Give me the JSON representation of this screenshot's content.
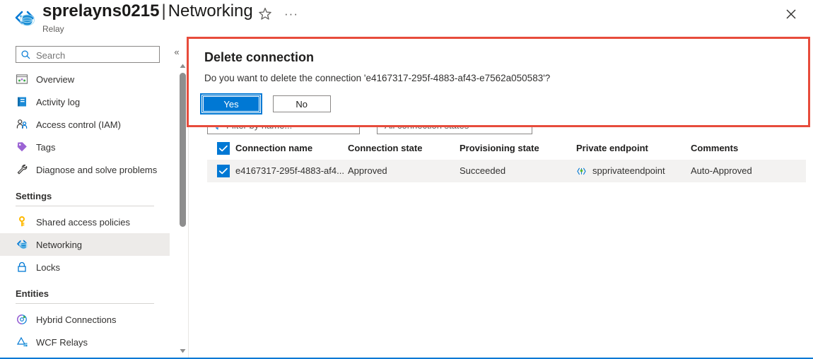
{
  "header": {
    "resource_name": "sprelayns0215",
    "separator": "|",
    "page_name": "Networking",
    "subtitle": "Relay",
    "resource_icon": "relay-icon",
    "favorite_icon": "star-icon",
    "more_icon": "ellipsis-icon",
    "close_icon": "close-icon"
  },
  "sidebar": {
    "search": {
      "placeholder": "Search",
      "value": "",
      "icon": "search-icon"
    },
    "collapse_icon": "chevron-double-left-icon",
    "items": [
      {
        "label": "Overview",
        "icon": "overview-icon",
        "selected": false
      },
      {
        "label": "Activity log",
        "icon": "activity-log-icon",
        "selected": false
      },
      {
        "label": "Access control (IAM)",
        "icon": "access-control-icon",
        "selected": false
      },
      {
        "label": "Tags",
        "icon": "tags-icon",
        "selected": false
      },
      {
        "label": "Diagnose and solve problems",
        "icon": "diagnose-icon",
        "selected": false
      }
    ],
    "groups": [
      {
        "title": "Settings",
        "items": [
          {
            "label": "Shared access policies",
            "icon": "key-icon",
            "selected": false
          },
          {
            "label": "Networking",
            "icon": "networking-icon",
            "selected": true
          },
          {
            "label": "Locks",
            "icon": "lock-icon",
            "selected": false
          }
        ]
      },
      {
        "title": "Entities",
        "items": [
          {
            "label": "Hybrid Connections",
            "icon": "hybrid-connections-icon",
            "selected": false
          },
          {
            "label": "WCF Relays",
            "icon": "wcf-relays-icon",
            "selected": false
          }
        ]
      }
    ],
    "scrollbar": {
      "up_icon": "scroll-up-arrow-icon",
      "down_icon": "scroll-down-arrow-icon"
    }
  },
  "filters": {
    "name_filter": {
      "placeholder": "Filter by name...",
      "value": "",
      "icon": "filter-icon"
    },
    "state_filter": {
      "value": "All connection states",
      "chevron": "chevron-down-icon"
    }
  },
  "table": {
    "select_all_checked": true,
    "columns": [
      "Connection name",
      "Connection state",
      "Provisioning state",
      "Private endpoint",
      "Comments"
    ],
    "rows": [
      {
        "checked": true,
        "connection_name": "e4167317-295f-4883-af4...",
        "connection_state": "Approved",
        "provisioning_state": "Succeeded",
        "private_endpoint": "spprivateendpoint",
        "private_endpoint_icon": "private-endpoint-icon",
        "comments": "Auto-Approved"
      }
    ]
  },
  "dialog": {
    "title": "Delete connection",
    "message": "Do you want to delete the connection 'e4167317-295f-4883-af43-e7562a050583'?",
    "confirm_label": "Yes",
    "cancel_label": "No"
  },
  "colors": {
    "accent": "#0078d4",
    "link": "#0067b8",
    "annotation": "#e74c3c",
    "selected_row": "#f3f2f1",
    "selected_nav": "#edebe9"
  }
}
